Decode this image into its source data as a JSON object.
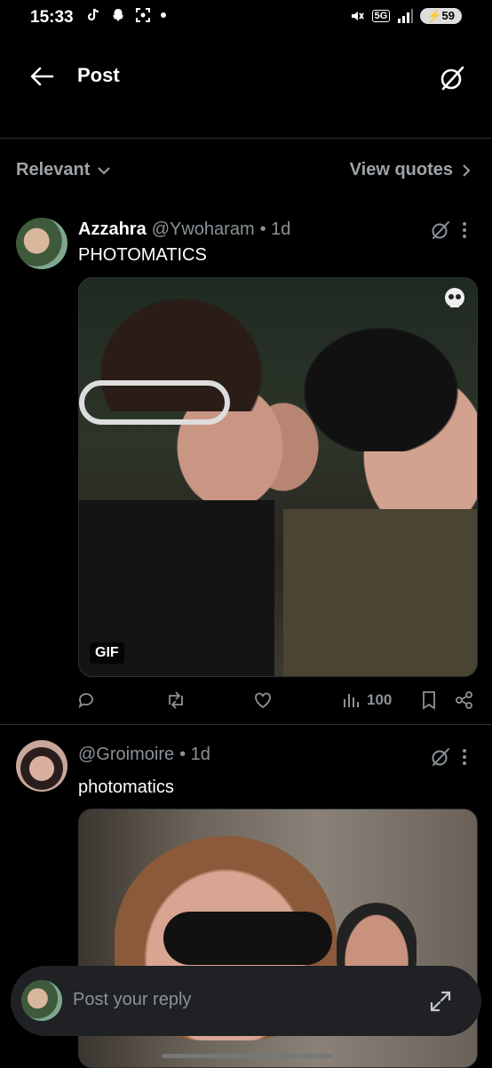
{
  "status_bar": {
    "time": "15:33",
    "network": "5G",
    "battery": "59"
  },
  "header": {
    "title": "Post",
    "back_icon": "arrow-left-icon",
    "grok_icon": "grok-icon"
  },
  "filters": {
    "sort_label": "Relevant",
    "quotes_label": "View quotes"
  },
  "tweets": [
    {
      "name": "Azzahra",
      "handle": "@Ywoharam",
      "time": "• 1d",
      "text": "PHOTOMATICS",
      "media_badge": "GIF",
      "views": "100"
    },
    {
      "name": "",
      "handle": "@Groimoire",
      "time": "• 1d",
      "text": "photomatics"
    }
  ],
  "reply": {
    "placeholder": "Post your reply"
  },
  "colors": {
    "background": "#000000",
    "muted": "#8b9297",
    "divider": "#2f3336"
  }
}
